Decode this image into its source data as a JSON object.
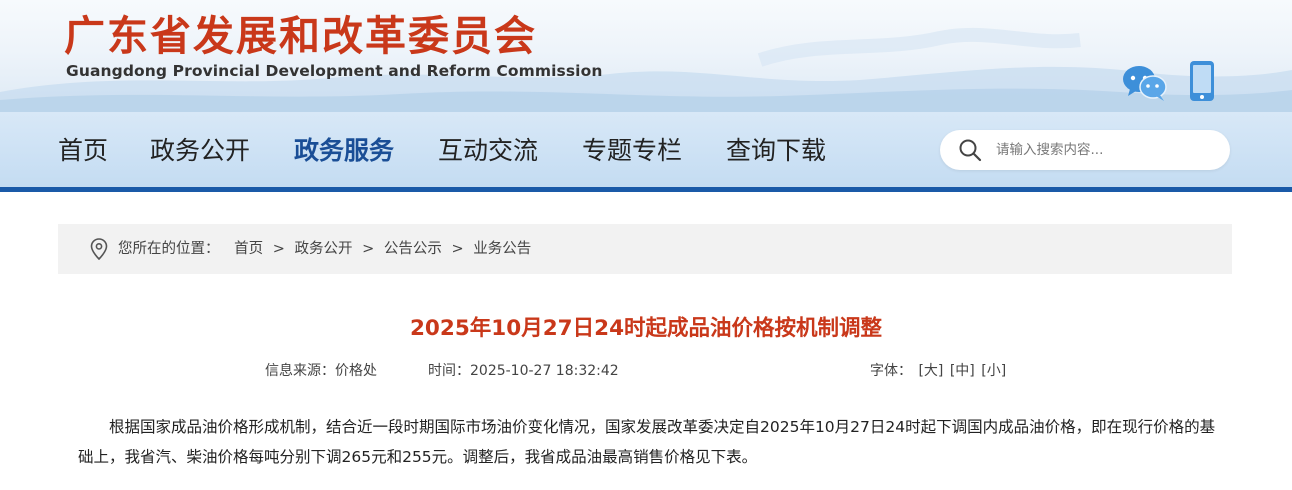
{
  "header": {
    "site_title": "广东省发展和改革委员会",
    "site_subtitle": "Guangdong Provincial Development and Reform Commission",
    "icons": [
      "wechat-icon",
      "mobile-icon"
    ],
    "title_color": "#c9381a"
  },
  "nav": {
    "items": [
      {
        "label": "首页",
        "active": false
      },
      {
        "label": "政务公开",
        "active": false
      },
      {
        "label": "政务服务",
        "active": true
      },
      {
        "label": "互动交流",
        "active": false
      },
      {
        "label": "专题专栏",
        "active": false
      },
      {
        "label": "查询下载",
        "active": false
      }
    ],
    "accent_color": "#1a5aa8"
  },
  "search": {
    "placeholder": "请输入搜索内容..."
  },
  "breadcrumb": {
    "prefix": "您所在的位置：",
    "items": [
      "首页",
      "政务公开",
      "公告公示",
      "业务公告"
    ],
    "separator": ">"
  },
  "article": {
    "title": "2025年10月27日24时起成品油价格按机制调整",
    "source_label": "信息来源：",
    "source_value": "价格处",
    "time_label": "时间：",
    "time_value": "2025-10-27 18:32:42",
    "font_label": "字体：",
    "font_options": [
      "[大]",
      "[中]",
      "[小]"
    ],
    "paragraph": "根据国家成品油价格形成机制，结合近一段时期国际市场油价变化情况，国家发展改革委决定自2025年10月27日24时起下调国内成品油价格，即在现行价格的基础上，我省汽、柴油价格每吨分别下调265元和255元。调整后，我省成品油最高销售价格见下表。"
  }
}
